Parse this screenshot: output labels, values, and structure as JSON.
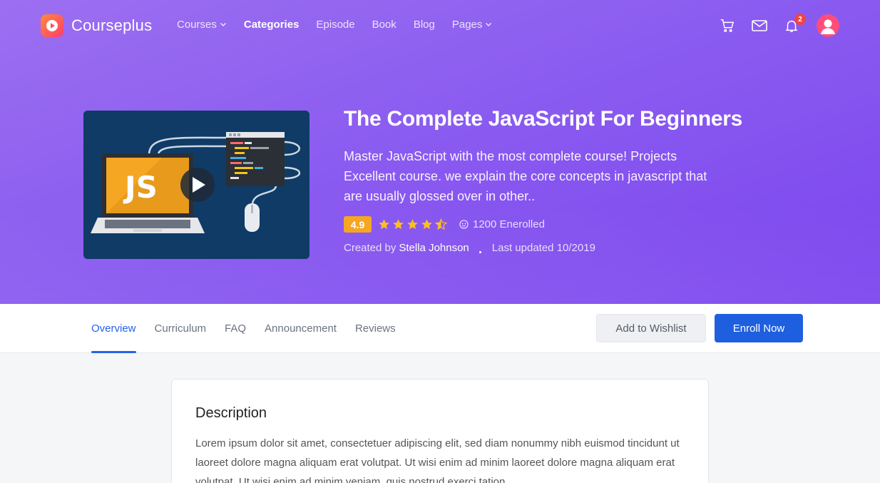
{
  "brand": {
    "name": "Courseplus",
    "accent": "#8b5cf0",
    "logo_gradient": [
      "#ff8a3d",
      "#ff3d6e"
    ]
  },
  "nav": {
    "items": [
      {
        "label": "Courses",
        "has_dropdown": true,
        "active": false
      },
      {
        "label": "Categories",
        "has_dropdown": false,
        "active": true
      },
      {
        "label": "Episode",
        "has_dropdown": false,
        "active": false
      },
      {
        "label": "Book",
        "has_dropdown": false,
        "active": false
      },
      {
        "label": "Blog",
        "has_dropdown": false,
        "active": false
      },
      {
        "label": "Pages",
        "has_dropdown": true,
        "active": false
      }
    ],
    "icons": [
      "cart-icon",
      "mail-icon",
      "bell-icon",
      "avatar"
    ],
    "notification_count": "2"
  },
  "course": {
    "thumbnail_text": "JS",
    "title": "The Complete JavaScript For Beginners",
    "description": "Master JavaScript with the most complete course! Projects Excellent course. we explain the core concepts in javascript that are usually glossed over in other..",
    "rating": "4.9",
    "stars": 4.5,
    "enrolled": "1200 Enerolled",
    "created_by_label": "Created by",
    "author": "Stella Johnson",
    "last_updated": "Last updated 10/2019"
  },
  "tabs": [
    {
      "label": "Overview",
      "active": true
    },
    {
      "label": "Curriculum",
      "active": false
    },
    {
      "label": "FAQ",
      "active": false
    },
    {
      "label": "Announcement",
      "active": false
    },
    {
      "label": "Reviews",
      "active": false
    }
  ],
  "actions": {
    "wishlist_label": "Add to Wishlist",
    "enroll_label": "Enroll Now"
  },
  "description_card": {
    "heading": "Description",
    "text": "Lorem ipsum dolor sit amet, consectetuer adipiscing elit, sed diam nonummy nibh euismod tincidunt ut laoreet dolore magna aliquam erat volutpat. Ut wisi enim ad minim laoreet dolore magna aliquam erat volutpat. Ut wisi enim ad minim veniam, quis nostrud exerci tation"
  }
}
